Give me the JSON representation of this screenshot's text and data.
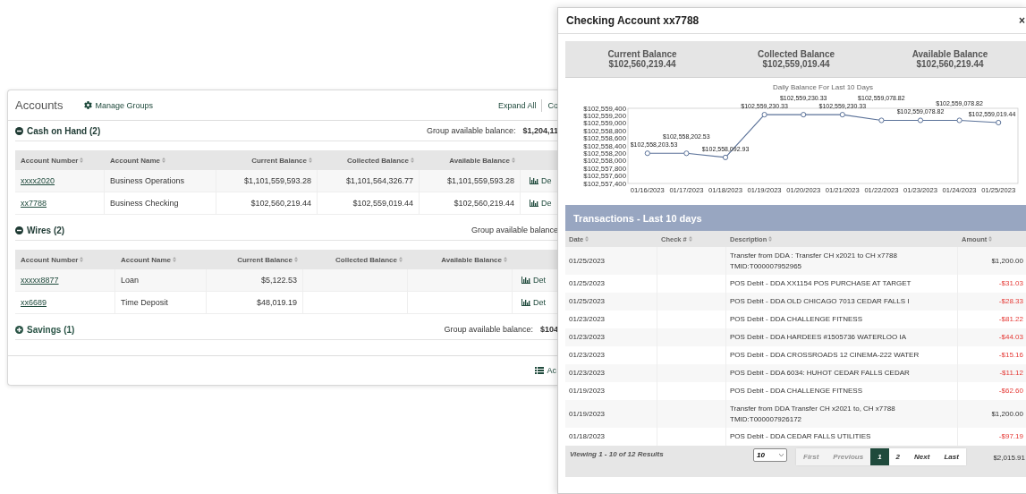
{
  "accounts_panel": {
    "title": "Accounts",
    "manage_groups": "Manage Groups",
    "expand_all": "Expand All",
    "collapse_cut": "Co",
    "groups": [
      {
        "name": "Cash on Hand (2)",
        "expanded": true,
        "balance_label": "Group available balance:",
        "balance": "$1,204,11",
        "columns": [
          "Account Number",
          "Account Name",
          "Current Balance",
          "Collected Balance",
          "Available Balance"
        ],
        "rows": [
          {
            "number": "xxxx2020",
            "name": "Business Operations",
            "current": "$1,101,559,593.28",
            "collected": "$1,101,564,326.77",
            "available": "$1,101,559,593.28",
            "details": "De"
          },
          {
            "number": "xx7788",
            "name": "Business Checking",
            "current": "$102,560,219.44",
            "collected": "$102,559,019.44",
            "available": "$102,560,219.44",
            "details": "De"
          }
        ]
      },
      {
        "name": "Wires (2)",
        "expanded": true,
        "balance_label": "Group available balance",
        "columns": [
          "Account Number",
          "Account Name",
          "Current Balance",
          "Collected Balance",
          "Available Balance"
        ],
        "rows": [
          {
            "number": "xxxxx8877",
            "name": "Loan",
            "current": "$5,122.53",
            "details": "Det"
          },
          {
            "number": "xx6689",
            "name": "Time Deposit",
            "current": "$48,019.19",
            "details": "Det"
          }
        ]
      },
      {
        "name": "Savings (1)",
        "expanded": false,
        "balance_label": "Group available balance:",
        "balance": "$104"
      }
    ],
    "footer_link": "Ac"
  },
  "modal": {
    "title": "Checking Account xx7788",
    "close": "×",
    "summary": [
      {
        "label": "Current Balance",
        "value": "$102,560,219.44"
      },
      {
        "label": "Collected Balance",
        "value": "$102,559,019.44"
      },
      {
        "label": "Available Balance",
        "value": "$102,560,219.44"
      }
    ],
    "chart_data": {
      "type": "line",
      "title": "Daily Balance For Last 10 Days",
      "categories": [
        "01/16/2023",
        "01/17/2023",
        "01/18/2023",
        "01/19/2023",
        "01/20/2023",
        "01/21/2023",
        "01/22/2023",
        "01/23/2023",
        "01/24/2023",
        "01/25/2023"
      ],
      "series": [
        {
          "color": "#5b7299",
          "marker": "circle",
          "values": [
            102558203.53,
            102558202.53,
            102558092.93,
            102559230.33,
            102559230.33,
            102559230.33,
            102559078.82,
            102559078.82,
            102559078.82,
            102559019.44
          ]
        }
      ],
      "ylim": [
        102557400,
        102559400
      ],
      "yticks": [
        {
          "value": 102557400,
          "label": "$102,557,400"
        },
        {
          "value": 102557600,
          "label": "$102,557,600"
        },
        {
          "value": 102557800,
          "label": "$102,557,800"
        },
        {
          "value": 102558000,
          "label": "$102,558,000"
        },
        {
          "value": 102558200,
          "label": "$102,558,200"
        },
        {
          "value": 102558400,
          "label": "$102,558,400"
        },
        {
          "value": 102558600,
          "label": "$102,558,600"
        },
        {
          "value": 102558800,
          "label": "$102,558,800"
        },
        {
          "value": 102559000,
          "label": "$102,559,000"
        },
        {
          "value": 102559200,
          "label": "$102,559,200"
        },
        {
          "value": 102559400,
          "label": "$102,559,400"
        }
      ],
      "value_labels": [
        "$102,558,203.53",
        "$102,558,202.53",
        "$102,558,092.93",
        "$102,559,230.33",
        "$102,559,230.33",
        "$102,559,230.33",
        "$102,559,078.82",
        "$102,559,078.82",
        "$102,559,078.82",
        "$102,559,019.44"
      ]
    },
    "transactions": {
      "title": "Transactions - Last 10 days",
      "columns": [
        "Date",
        "Check #",
        "Description",
        "Amount"
      ],
      "rows": [
        {
          "date": "01/25/2023",
          "description": "Transfer from DDA : Transfer CH x2021 to CH x7788 TMID:T000007952965",
          "amount": "$1,200.00",
          "kind": "credit"
        },
        {
          "date": "01/25/2023",
          "description": "POS Debit - DDA XX1154 POS PURCHASE AT TARGET",
          "amount": "-$31.03",
          "kind": "debit"
        },
        {
          "date": "01/25/2023",
          "description": "POS Debit - DDA OLD CHICAGO 7013 CEDAR FALLS I",
          "amount": "-$28.33",
          "kind": "debit"
        },
        {
          "date": "01/23/2023",
          "description": "POS Debit - DDA CHALLENGE FITNESS",
          "amount": "-$81.22",
          "kind": "debit"
        },
        {
          "date": "01/23/2023",
          "description": "POS Debit - DDA HARDEES #1505736 WATERLOO IA",
          "amount": "-$44.03",
          "kind": "debit"
        },
        {
          "date": "01/23/2023",
          "description": "POS Debit - DDA CROSSROADS 12 CINEMA-222 WATER",
          "amount": "-$15.16",
          "kind": "debit"
        },
        {
          "date": "01/23/2023",
          "description": "POS Debit - DDA 6034: HUHOT CEDAR FALLS CEDAR",
          "amount": "-$11.12",
          "kind": "debit"
        },
        {
          "date": "01/19/2023",
          "description": "POS Debit - DDA CHALLENGE FITNESS",
          "amount": "-$62.60",
          "kind": "debit"
        },
        {
          "date": "01/19/2023",
          "description": "Transfer from DDA Transfer CH x2021 to, CH x7788 TMID:T000007926172",
          "amount": "$1,200.00",
          "kind": "credit"
        },
        {
          "date": "01/18/2023",
          "description": "POS Debit - DDA CEDAR FALLS UTILITIES",
          "amount": "-$97.19",
          "kind": "debit"
        }
      ]
    },
    "footer": {
      "viewing": "Viewing 1 - 10 of 12 Results",
      "page_size": "10",
      "pager": [
        {
          "label": "First",
          "disabled": true,
          "selected": false
        },
        {
          "label": "Previous",
          "disabled": true,
          "selected": false
        },
        {
          "label": "1",
          "disabled": false,
          "selected": true
        },
        {
          "label": "2",
          "disabled": false,
          "selected": false
        },
        {
          "label": "Next",
          "disabled": false,
          "selected": false
        },
        {
          "label": "Last",
          "disabled": false,
          "selected": false
        }
      ],
      "total": "$2,015.91"
    }
  }
}
